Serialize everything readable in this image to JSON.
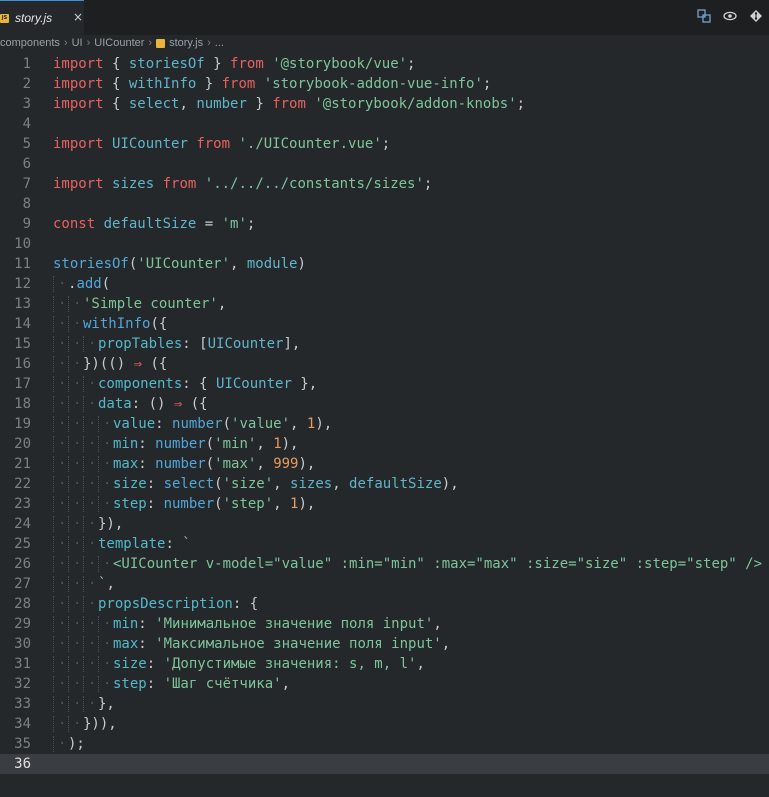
{
  "tab": {
    "filename": "story.js",
    "icon": "js",
    "close": "×"
  },
  "breadcrumb": [
    "components",
    "UI",
    "UICounter",
    "story.js",
    "..."
  ],
  "current_line": 36,
  "lines": [
    [
      [
        "kw",
        "import"
      ],
      [
        "txt",
        " { "
      ],
      [
        "var",
        "storiesOf"
      ],
      [
        "txt",
        " } "
      ],
      [
        "kw",
        "from"
      ],
      [
        "txt",
        " "
      ],
      [
        "str",
        "'@storybook/vue'"
      ],
      [
        "txt",
        ";"
      ]
    ],
    [
      [
        "kw",
        "import"
      ],
      [
        "txt",
        " { "
      ],
      [
        "var",
        "withInfo"
      ],
      [
        "txt",
        " } "
      ],
      [
        "kw",
        "from"
      ],
      [
        "txt",
        " "
      ],
      [
        "str",
        "'storybook-addon-vue-info'"
      ],
      [
        "txt",
        ";"
      ]
    ],
    [
      [
        "kw",
        "import"
      ],
      [
        "txt",
        " { "
      ],
      [
        "var",
        "select"
      ],
      [
        "txt",
        ", "
      ],
      [
        "var",
        "number"
      ],
      [
        "txt",
        " } "
      ],
      [
        "kw",
        "from"
      ],
      [
        "txt",
        " "
      ],
      [
        "str",
        "'@storybook/addon-knobs'"
      ],
      [
        "txt",
        ";"
      ]
    ],
    [],
    [
      [
        "kw",
        "import"
      ],
      [
        "txt",
        " "
      ],
      [
        "var",
        "UICounter"
      ],
      [
        "txt",
        " "
      ],
      [
        "kw",
        "from"
      ],
      [
        "txt",
        " "
      ],
      [
        "str",
        "'./UICounter.vue'"
      ],
      [
        "txt",
        ";"
      ]
    ],
    [],
    [
      [
        "kw",
        "import"
      ],
      [
        "txt",
        " "
      ],
      [
        "var",
        "sizes"
      ],
      [
        "txt",
        " "
      ],
      [
        "kw",
        "from"
      ],
      [
        "txt",
        " "
      ],
      [
        "str",
        "'../../../constants/sizes'"
      ],
      [
        "txt",
        ";"
      ]
    ],
    [],
    [
      [
        "kw",
        "const"
      ],
      [
        "txt",
        " "
      ],
      [
        "var",
        "defaultSize"
      ],
      [
        "txt",
        " = "
      ],
      [
        "str",
        "'m'"
      ],
      [
        "txt",
        ";"
      ]
    ],
    [],
    [
      [
        "fn",
        "storiesOf"
      ],
      [
        "txt",
        "("
      ],
      [
        "str",
        "'UICounter'"
      ],
      [
        "txt",
        ", "
      ],
      [
        "var",
        "module"
      ],
      [
        "txt",
        ")"
      ]
    ],
    [
      [
        "ind",
        1
      ],
      [
        "txt",
        "."
      ],
      [
        "fn",
        "add"
      ],
      [
        "txt",
        "("
      ]
    ],
    [
      [
        "ind",
        2
      ],
      [
        "str",
        "'Simple counter'"
      ],
      [
        "txt",
        ","
      ]
    ],
    [
      [
        "ind",
        2
      ],
      [
        "fn",
        "withInfo"
      ],
      [
        "txt",
        "({"
      ]
    ],
    [
      [
        "ind",
        3
      ],
      [
        "prop",
        "propTables"
      ],
      [
        "txt",
        ": ["
      ],
      [
        "var",
        "UICounter"
      ],
      [
        "txt",
        "],"
      ]
    ],
    [
      [
        "ind",
        2
      ],
      [
        "txt",
        "})(() "
      ],
      [
        "kw",
        "⇒"
      ],
      [
        "txt",
        " ({"
      ]
    ],
    [
      [
        "ind",
        3
      ],
      [
        "prop",
        "components"
      ],
      [
        "txt",
        ": { "
      ],
      [
        "var",
        "UICounter"
      ],
      [
        "txt",
        " },"
      ]
    ],
    [
      [
        "ind",
        3
      ],
      [
        "prop",
        "data"
      ],
      [
        "txt",
        ": () "
      ],
      [
        "kw",
        "⇒"
      ],
      [
        "txt",
        " ({"
      ]
    ],
    [
      [
        "ind",
        4
      ],
      [
        "prop",
        "value"
      ],
      [
        "txt",
        ": "
      ],
      [
        "fn",
        "number"
      ],
      [
        "txt",
        "("
      ],
      [
        "str",
        "'value'"
      ],
      [
        "txt",
        ", "
      ],
      [
        "num",
        "1"
      ],
      [
        "txt",
        "),"
      ]
    ],
    [
      [
        "ind",
        4
      ],
      [
        "prop",
        "min"
      ],
      [
        "txt",
        ": "
      ],
      [
        "fn",
        "number"
      ],
      [
        "txt",
        "("
      ],
      [
        "str",
        "'min'"
      ],
      [
        "txt",
        ", "
      ],
      [
        "num",
        "1"
      ],
      [
        "txt",
        "),"
      ]
    ],
    [
      [
        "ind",
        4
      ],
      [
        "prop",
        "max"
      ],
      [
        "txt",
        ": "
      ],
      [
        "fn",
        "number"
      ],
      [
        "txt",
        "("
      ],
      [
        "str",
        "'max'"
      ],
      [
        "txt",
        ", "
      ],
      [
        "num",
        "999"
      ],
      [
        "txt",
        "),"
      ]
    ],
    [
      [
        "ind",
        4
      ],
      [
        "prop",
        "size"
      ],
      [
        "txt",
        ": "
      ],
      [
        "fn",
        "select"
      ],
      [
        "txt",
        "("
      ],
      [
        "str",
        "'size'"
      ],
      [
        "txt",
        ", "
      ],
      [
        "var",
        "sizes"
      ],
      [
        "txt",
        ", "
      ],
      [
        "var",
        "defaultSize"
      ],
      [
        "txt",
        "),"
      ]
    ],
    [
      [
        "ind",
        4
      ],
      [
        "prop",
        "step"
      ],
      [
        "txt",
        ": "
      ],
      [
        "fn",
        "number"
      ],
      [
        "txt",
        "("
      ],
      [
        "str",
        "'step'"
      ],
      [
        "txt",
        ", "
      ],
      [
        "num",
        "1"
      ],
      [
        "txt",
        "),"
      ]
    ],
    [
      [
        "ind",
        3
      ],
      [
        "txt",
        "}),"
      ]
    ],
    [
      [
        "ind",
        3
      ],
      [
        "prop",
        "template"
      ],
      [
        "txt",
        ": "
      ],
      [
        "str",
        "`"
      ]
    ],
    [
      [
        "ind",
        4
      ],
      [
        "str",
        "<UICounter v-model=\"value\" :min=\"min\" :max=\"max\" :size=\"size\" :step=\"step\" />"
      ]
    ],
    [
      [
        "ind",
        3
      ],
      [
        "str",
        "`"
      ],
      [
        "txt",
        ","
      ]
    ],
    [
      [
        "ind",
        3
      ],
      [
        "prop",
        "propsDescription"
      ],
      [
        "txt",
        ": {"
      ]
    ],
    [
      [
        "ind",
        4
      ],
      [
        "prop",
        "min"
      ],
      [
        "txt",
        ": "
      ],
      [
        "str",
        "'Минимальное значение поля input'"
      ],
      [
        "txt",
        ","
      ]
    ],
    [
      [
        "ind",
        4
      ],
      [
        "prop",
        "max"
      ],
      [
        "txt",
        ": "
      ],
      [
        "str",
        "'Максимальное значение поля input'"
      ],
      [
        "txt",
        ","
      ]
    ],
    [
      [
        "ind",
        4
      ],
      [
        "prop",
        "size"
      ],
      [
        "txt",
        ": "
      ],
      [
        "str",
        "'Допустимые значения: s, m, l'"
      ],
      [
        "txt",
        ","
      ]
    ],
    [
      [
        "ind",
        4
      ],
      [
        "prop",
        "step"
      ],
      [
        "txt",
        ": "
      ],
      [
        "str",
        "'Шаг счётчика'"
      ],
      [
        "txt",
        ","
      ]
    ],
    [
      [
        "ind",
        3
      ],
      [
        "txt",
        "},"
      ]
    ],
    [
      [
        "ind",
        2
      ],
      [
        "txt",
        "})),"
      ]
    ],
    [
      [
        "ind",
        1
      ],
      [
        "txt",
        ");"
      ]
    ],
    []
  ]
}
